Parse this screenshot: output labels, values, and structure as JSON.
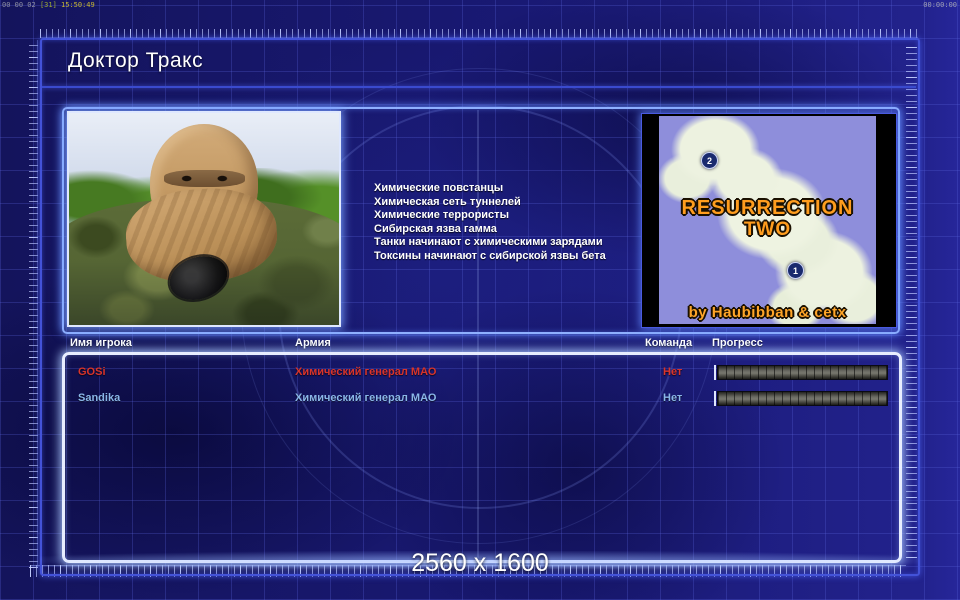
{
  "debug": {
    "left_time": "00 00 02",
    "left_fps": "[31]",
    "left_clock": "15:50:49",
    "right_timer": "00:00:00"
  },
  "header": {
    "title": "Доктор Тракс"
  },
  "briefing": {
    "features": [
      "Химические повстанцы",
      "Химическая сеть туннелей",
      "Химические террористы",
      "Сибирская язва гамма",
      "Танки начинают с химическими зарядами",
      "Токсины начинают с сибирской язвы бета"
    ]
  },
  "map_preview": {
    "title_line1": "RESURRECTION",
    "title_line2": "TWO",
    "credit": "by Haubibban & cetx",
    "marker_1": "1",
    "marker_2": "2"
  },
  "players": {
    "columns": {
      "name": "Имя игрока",
      "army": "Армия",
      "team": "Команда",
      "progress": "Прогресс"
    },
    "rows": [
      {
        "name": "GOSi",
        "army": "Химический генерал МАО",
        "team": "Нет",
        "color": "#d8342a",
        "progress_percent": 100
      },
      {
        "name": "Sandika",
        "army": "Химический генерал МАО",
        "team": "Нет",
        "color": "#8ab6e8",
        "progress_percent": 100
      }
    ]
  },
  "footer": {
    "resolution": "2560 x 1600"
  },
  "colors": {
    "background": "#191974",
    "frame_accent": "#4352d8",
    "panel_glow": "#8fb0ff",
    "table_border": "#e8eeff",
    "row_red": "#d8342a",
    "row_blue": "#8ab6e8",
    "map_background": "#8e8edb",
    "map_title_orange": "#ff9d1e",
    "progress_segment": "#6b6b63"
  }
}
